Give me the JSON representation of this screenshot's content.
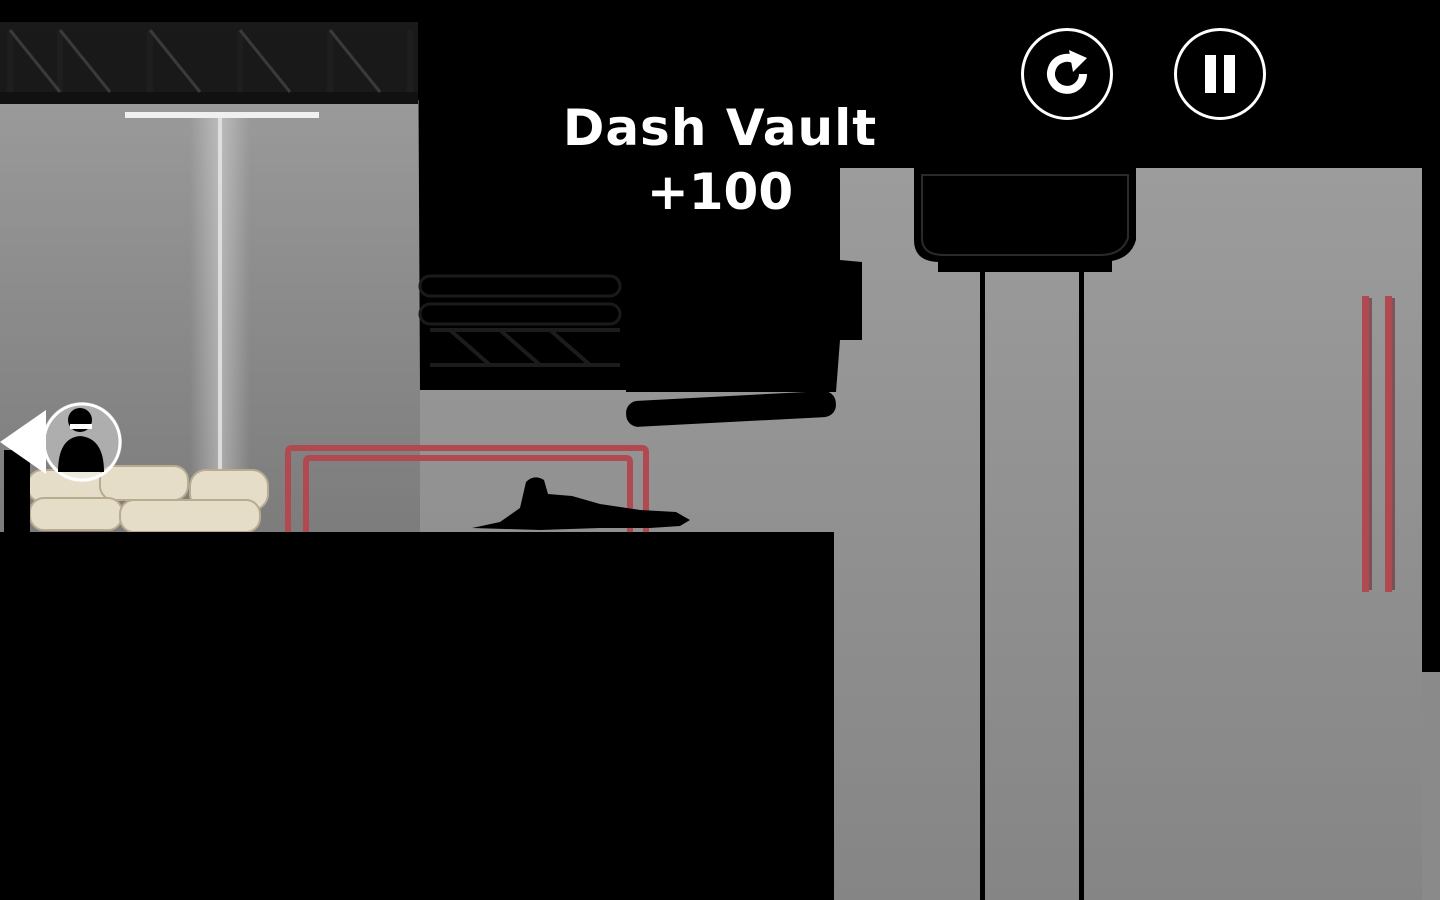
{
  "hud": {
    "trick_name": "Dash Vault",
    "trick_score": "+100",
    "restart_icon": "restart-icon",
    "pause_icon": "pause-icon"
  },
  "colors": {
    "wall": "#8c8c8c",
    "wall_dark": "#6f6f6f",
    "silhouette": "#000000",
    "pipe_red": "#b04a50",
    "sandbag": "#e8dfcc",
    "hud_white": "#ffffff"
  },
  "scene": {
    "chaser_indicator": "hunter-offscreen-indicator",
    "player": "runner-silhouette"
  }
}
